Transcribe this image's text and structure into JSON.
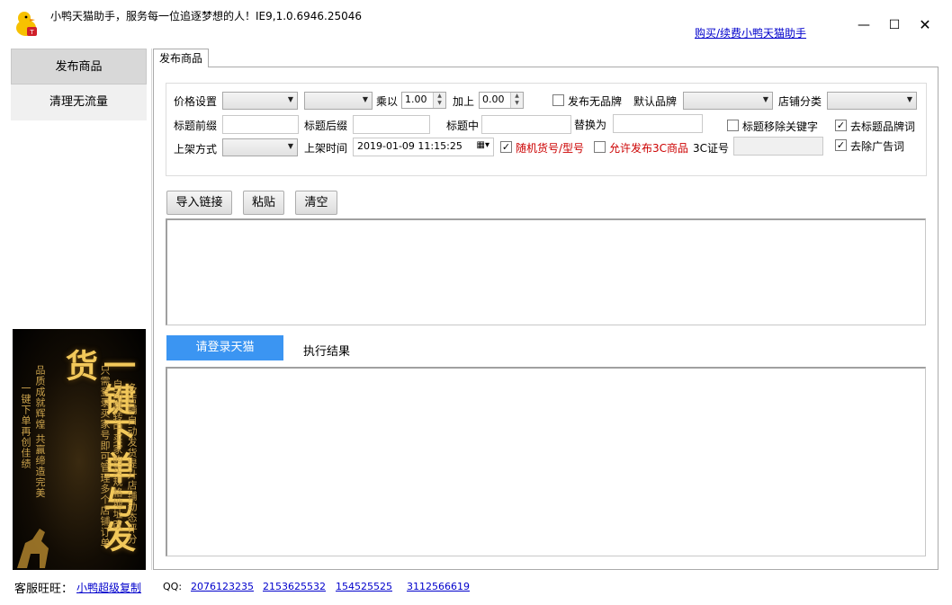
{
  "window": {
    "title": "小鸭天猫助手，服务每一位追逐梦想的人！IE9,1.0.6946.25046",
    "buy_link": "购买/续费小鸭天猫助手",
    "minimize": "—",
    "maximize": "☐",
    "close": "✕"
  },
  "sidebar": {
    "items": [
      {
        "label": "发布商品"
      },
      {
        "label": "清理无流量"
      }
    ]
  },
  "ad": {
    "main_text": "一键下单与发货",
    "columns": [
      "一键下单再创佳绩",
      "品质成就辉煌 共赢缔造完美",
      "只需登录买家号即可管理多个店铺订单",
      "自动跳转中买家购买规格地址改",
      "多店铺自动发货提升店铺动态评分"
    ]
  },
  "tab": {
    "label": "发布商品"
  },
  "settings": {
    "price_label": "价格设置",
    "multiply_label": "乘以",
    "multiply_value": "1.00",
    "add_label": "加上",
    "add_value": "0.00",
    "no_brand_label": "发布无品牌",
    "no_brand_checked": false,
    "default_brand_label": "默认品牌",
    "shop_category_label": "店铺分类",
    "title_prefix_label": "标题前缀",
    "title_suffix_label": "标题后缀",
    "title_middle_label": "标题中",
    "replace_label": "替换为",
    "remove_keyword_label": "标题移除关键字",
    "remove_keyword_checked": false,
    "remove_brand_word_label": "去标题品牌词",
    "remove_brand_word_checked": true,
    "listing_mode_label": "上架方式",
    "listing_time_label": "上架时间",
    "listing_time_value": "2019-01-09 11:15:25",
    "random_model_label": "随机货号/型号",
    "random_model_checked": true,
    "allow_3c_label": "允许发布3C商品",
    "allow_3c_checked": false,
    "cert_3c_label": "3C证号",
    "remove_ad_word_label": "去除广告词",
    "remove_ad_word_checked": true
  },
  "buttons": {
    "import": "导入链接",
    "paste": "粘贴",
    "clear": "清空"
  },
  "results": {
    "login_tab": "请登录天猫",
    "result_tab": "执行结果"
  },
  "footer": {
    "service_label": "客服旺旺：",
    "service_link": "小鸭超级复制",
    "qq_label": "QQ:",
    "qq_numbers": [
      "2076123235",
      "2153625532",
      "154525525",
      "3112566619"
    ]
  },
  "colors": {
    "accent_blue": "#3b95f2",
    "link": "#0000cc",
    "red_label": "#cc0000"
  }
}
